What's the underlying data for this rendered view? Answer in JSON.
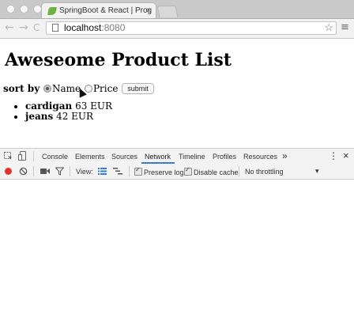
{
  "window": {
    "tab_title": "SpringBoot & React | Prog",
    "tab_close": "×",
    "address_host": "localhost",
    "address_port": ":8080",
    "back_glyph": "←",
    "forward_glyph": "→",
    "reload_glyph": "C",
    "star_glyph": "☆",
    "menu_glyph": "≡"
  },
  "page": {
    "title": "Aweseome Product List",
    "sort_label": "sort by",
    "sort_options": [
      {
        "label": "Name",
        "checked": true
      },
      {
        "label": "Price",
        "checked": false
      }
    ],
    "submit_label": "submit",
    "products": [
      {
        "name": "cardigan",
        "price": "63 EUR"
      },
      {
        "name": "jeans",
        "price": "42 EUR"
      }
    ]
  },
  "devtools": {
    "tabs": [
      "Console",
      "Elements",
      "Sources",
      "Network",
      "Timeline",
      "Profiles",
      "Resources"
    ],
    "active_tab": "Network",
    "more_glyph": "»",
    "kebab_glyph": "⋮",
    "close_glyph": "×",
    "view_label": "View:",
    "preserve_log_label": "Preserve log",
    "preserve_log_checked": true,
    "disable_cache_label": "Disable cache",
    "disable_cache_checked": true,
    "throttling_value": "No throttling",
    "dropdown_glyph": "▾"
  },
  "colors": {
    "record_active": "#e0352f",
    "active_tab_underline": "#3879d9",
    "spring_green": "#6db33f"
  }
}
